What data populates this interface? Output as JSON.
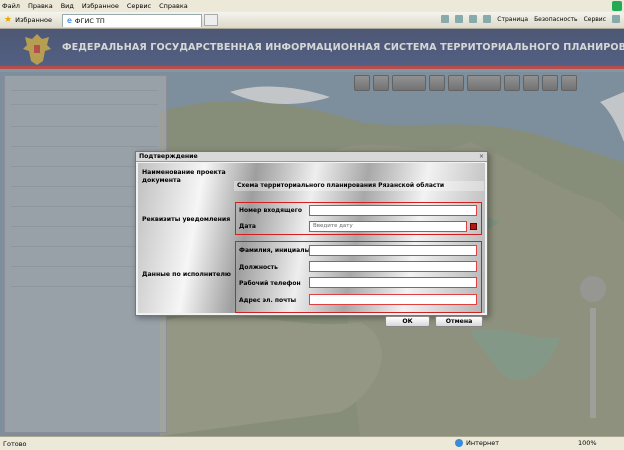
{
  "browser": {
    "menu": [
      "Файл",
      "Правка",
      "Вид",
      "Избранное",
      "Сервис",
      "Справка"
    ],
    "favorites_label": "Избранное",
    "tab_title": "ФГИС ТП",
    "tools": [
      "Страница",
      "Безопасность",
      "Сервис"
    ],
    "status_text": "Готово",
    "zone_text": "Интернет",
    "zoom_level": "100%"
  },
  "banner": {
    "title": "ФЕДЕРАЛЬНАЯ ГОСУДАРСТВЕННАЯ ИНФОРМАЦИОННАЯ СИСТЕМА ТЕРРИТОРИАЛЬНОГО ПЛАНИРОВАНИЯ"
  },
  "dialog": {
    "title": "Подтверждение",
    "project_label": "Наименование проекта документа",
    "project_value": "Схема территориального планирования Рязанской области",
    "notice_label": "Реквизиты уведомления",
    "incoming_number_label": "Номер входящего",
    "date_label": "Дата",
    "date_placeholder": "Введите дату",
    "executor_label": "Данные по исполнителю",
    "name_label": "Фамилия, инициалы",
    "position_label": "Должность",
    "phone_label": "Рабочий телефон",
    "email_label": "Адрес эл. почты",
    "ok_label": "ОК",
    "cancel_label": "Отмена"
  },
  "colors": {
    "banner_bg": "#2b3f78",
    "banner_stripe": "#cc2222",
    "field_border": "#e04040"
  }
}
